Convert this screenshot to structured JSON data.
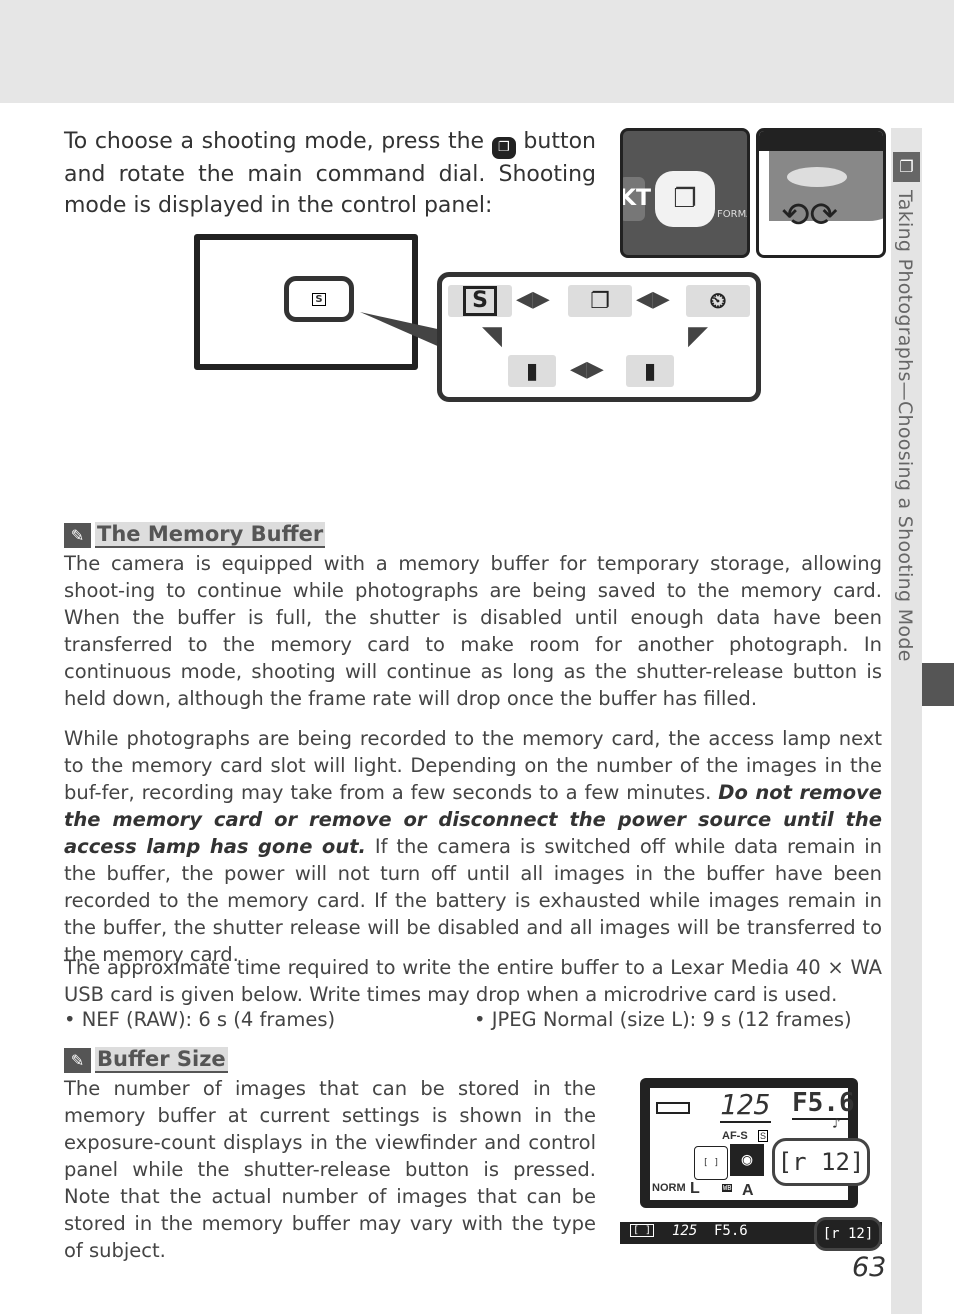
{
  "side_tab": {
    "title": "Taking Photographs—Choosing a Shooting Mode",
    "icon": "continuous-mode-icon"
  },
  "intro": {
    "before_icon": "To choose a shooting mode, press the",
    "after_icon": "button and rotate the main command dial.  Shooting mode is displayed in the control panel:"
  },
  "illustration": {
    "button_photo": {
      "labels": [
        "KT",
        "FORMA"
      ]
    },
    "viewfinder_indicator": "S",
    "modes": [
      "S",
      "continuous",
      "self-timer",
      "remote",
      "delayed remote"
    ]
  },
  "memory_buffer": {
    "heading": "The Memory Buffer",
    "p1": "The camera is equipped with a memory buffer for temporary storage, allowing shoot-ing to continue while photographs are being saved to the memory card.  When the buffer is full, the shutter is disabled until enough data have been transferred to the memory card to make room for another photograph.  In continuous mode, shooting will continue as long as the shutter-release button is held down, although the frame rate will drop once the buffer has filled.",
    "p2_a": "While photographs are being recorded to the memory card, the access lamp next to the memory card slot will light.  Depending on the number of the images in the buf-fer, recording may take from a few seconds to a few minutes.  ",
    "p2_italic": "Do not remove the memory card or remove or disconnect the power source until the access lamp has gone out.",
    "p2_b": "  If the camera is switched off while data remain in the buffer, the power will not turn off until all images in the buffer have been recorded to the memory card.  If the battery is exhausted while images remain in the buffer, the shutter release will be disabled and all images will be transferred to the memory card.",
    "p3": "The approximate time required to write the entire buffer to a Lexar Media 40 × WA USB card is given below.  Write times may drop when a microdrive card is used.",
    "bullets": [
      "• NEF (RAW): 6 s (4 frames)",
      "• JPEG Normal (size L): 9 s (12 frames)"
    ]
  },
  "buffer_size": {
    "heading": "Buffer Size",
    "text": "The number of images that can be stored in the memory buffer at current settings is shown in the exposure-count displays in the viewfinder and control panel while the shutter-release button is pressed.  Note that the actual number of images that can be stored in the memory buffer may vary with the type of subject."
  },
  "control_panel": {
    "shutter": "125",
    "aperture": "F5.6",
    "af_mode": "AF-S",
    "release_mode": "S",
    "quality": "NORM",
    "size": "L",
    "wb_label": "WB",
    "wb": "A",
    "count": "[r 12]",
    "vf_shutter": "125",
    "vf_aperture": "F5.6",
    "vf_count": "[r 12]"
  },
  "page_number": "63"
}
